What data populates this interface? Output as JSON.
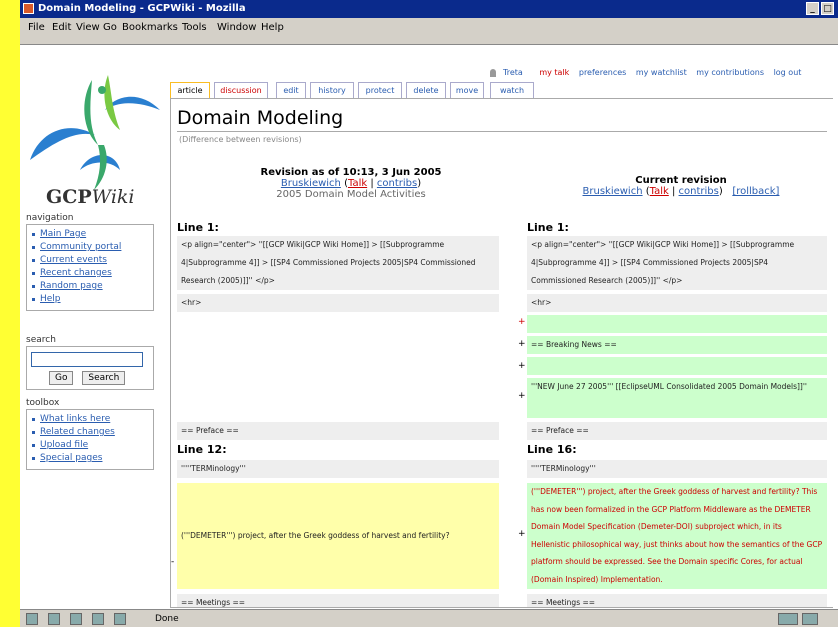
{
  "window": {
    "title": "Domain Modeling - GCPWiki - Mozilla",
    "controls": [
      "_",
      "□"
    ]
  },
  "menu": [
    "File",
    "Edit",
    "View",
    "Go",
    "Bookmarks",
    "Tools",
    "Window",
    "Help"
  ],
  "logo": {
    "text_main": "GCP",
    "text_italic": "Wiki"
  },
  "navigation": {
    "title": "navigation",
    "items": [
      "Main Page",
      "Community portal",
      "Current events",
      "Recent changes",
      "Random page",
      "Help"
    ]
  },
  "search": {
    "title": "search",
    "go_label": "Go",
    "search_label": "Search"
  },
  "toolbox": {
    "title": "toolbox",
    "items": [
      "What links here",
      "Related changes",
      "Upload file",
      "Special pages"
    ]
  },
  "personal": [
    "Treta",
    "my talk",
    "preferences",
    "my watchlist",
    "my contributions",
    "log out"
  ],
  "tabs": [
    "article",
    "discussion",
    "edit",
    "history",
    "protect",
    "delete",
    "move",
    "watch"
  ],
  "page": {
    "title": "Domain Modeling",
    "subtitle": "(Difference between revisions)"
  },
  "old_rev": {
    "title": "Revision as of 10:13, 3 Jun 2005",
    "user": "Bruskiewich",
    "talk": "Talk",
    "contribs": "contribs",
    "summary": "2005 Domain Model Activities"
  },
  "new_rev": {
    "title": "Current revision",
    "user": "Bruskiewich",
    "talk": "Talk",
    "contribs": "contribs",
    "rollback": "[rollback]"
  },
  "diff": {
    "hunk1_left": "Line 1:",
    "hunk1_right": "Line 1:",
    "ctx1": "<p align=\"center\"> ''[[GCP Wiki|GCP Wiki Home]] > [[Subprogramme 4|Subprogramme 4]] > [[SP4 Commissioned Projects 2005|SP4 Commissioned Research (2005)]]'' </p>",
    "ctx2": "<hr>",
    "add1": "",
    "add2": "== Breaking News ==",
    "add3": "",
    "add4": "'''NEW June 27 2005''' [[EclipseUML Consolidated 2005 Domain Models]]''",
    "ctx3": "== Preface ==",
    "hunk2_left": "Line 12:",
    "hunk2_right": "Line 16:",
    "ctx4": "'''''TERMinology'''",
    "del1": "('''DEMETER''') project, after the Greek goddess of harvest and fertility?",
    "add5": "('''DEMETER''') project, after the Greek goddess of harvest and fertility? This has now been formalized in the GCP Platform Middleware as the DEMETER Domain Model Specification (Demeter-DOI) subproject which, in its Hellenistic philosophical way, just thinks about how the semantics of the GCP platform should be expressed. See the Domain specific Cores, for actual (Domain Inspired) Implementation.",
    "ctx5": "== Meetings =="
  },
  "status": {
    "text": "Done"
  }
}
